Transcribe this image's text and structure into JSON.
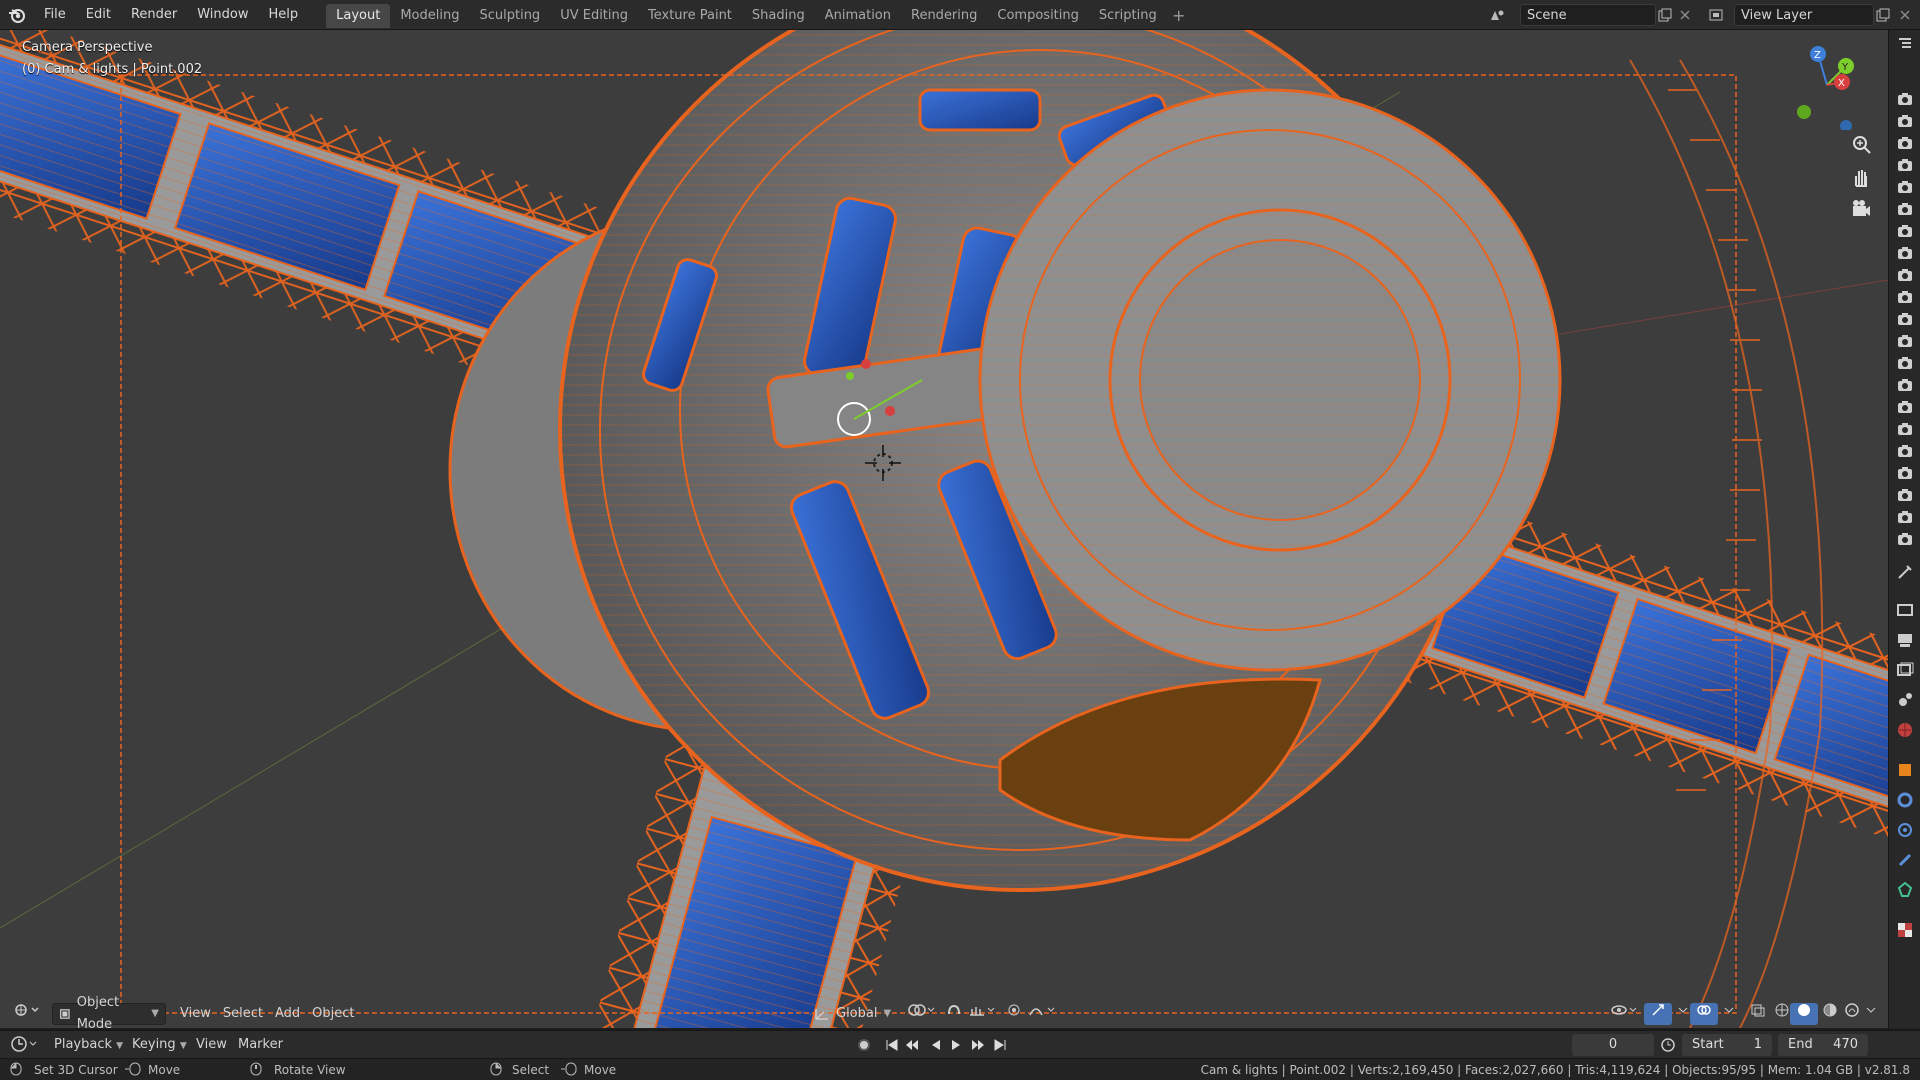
{
  "topbar": {
    "menus": [
      "File",
      "Edit",
      "Render",
      "Window",
      "Help"
    ],
    "workspaces": [
      "Layout",
      "Modeling",
      "Sculpting",
      "UV Editing",
      "Texture Paint",
      "Shading",
      "Animation",
      "Rendering",
      "Compositing",
      "Scripting"
    ],
    "active_workspace": "Layout",
    "add_workspace": "+",
    "scene": "Scene",
    "view_layer": "View Layer"
  },
  "viewport": {
    "perspective": "Camera Perspective",
    "object_info": "(0) Cam & lights | Point.002"
  },
  "header": {
    "mode": "Object Mode",
    "view": "View",
    "select": "Select",
    "add": "Add",
    "object": "Object",
    "orientation": "Global"
  },
  "timeline": {
    "playback": "Playback",
    "keying": "Keying",
    "view": "View",
    "marker": "Marker",
    "current_frame": "0",
    "start_label": "Start",
    "start": "1",
    "end_label": "End",
    "end": "470"
  },
  "statusbar": {
    "hint1": "Set 3D Cursor",
    "hint2": "Move",
    "hint3": "Rotate View",
    "hint4": "Select",
    "hint5": "Move",
    "stats": "Cam & lights | Point.002 | Verts:2,169,450 | Faces:2,027,660 | Tris:4,119,624 | Objects:95/95 | Mem: 1.04 GB | v2.81.8"
  },
  "colors": {
    "accent_orange": "#e8641e",
    "window_blue": "#2f5fc0",
    "active_tab": "#474747"
  }
}
